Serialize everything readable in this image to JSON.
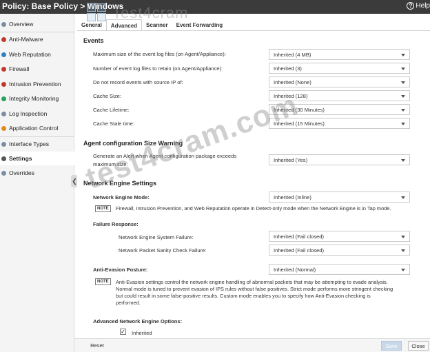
{
  "window": {
    "title": "Policy: Base Policy > Windows",
    "help": "Help"
  },
  "watermark": {
    "top": "Test4cram",
    "diagonal": "test4cram.com"
  },
  "sidebar": {
    "items": [
      {
        "label": "Overview",
        "color": "#7a8da3"
      },
      {
        "label": "Anti-Malware",
        "color": "#c0392b"
      },
      {
        "label": "Web Reputation",
        "color": "#2c80c5"
      },
      {
        "label": "Firewall",
        "color": "#c0392b"
      },
      {
        "label": "Intrusion Prevention",
        "color": "#c0392b"
      },
      {
        "label": "Integrity Monitoring",
        "color": "#27a060"
      },
      {
        "label": "Log Inspection",
        "color": "#7a8da3"
      },
      {
        "label": "Application Control",
        "color": "#e08a1e"
      },
      {
        "label": "Interface Types",
        "color": "#7a8da3"
      },
      {
        "label": "Settings",
        "color": "#555555"
      },
      {
        "label": "Overrides",
        "color": "#7a8da3"
      }
    ]
  },
  "tabs": [
    "General",
    "Advanced",
    "Scanner",
    "Event Forwarding"
  ],
  "events": {
    "heading": "Events",
    "rows": [
      {
        "label": "Maximum size of the event log files (on Agent/Appliance):",
        "value": "Inherited (4 MB)"
      },
      {
        "label": "Number of event log files to retain (on Agent/Appliance):",
        "value": "Inherited (3)"
      },
      {
        "label": "Do not record events with source IP of:",
        "value": "Inherited (None)"
      },
      {
        "label": "Cache Size:",
        "value": "Inherited (128)"
      },
      {
        "label": "Cache Lifetime:",
        "value": "Inherited (30 Minutes)"
      },
      {
        "label": "Cache Stale time:",
        "value": "Inherited (15 Minutes)"
      }
    ]
  },
  "agent_config": {
    "heading": "Agent configuration Size Warning",
    "label_line1": "Generate an Alert when Agent configuration package exceeds",
    "label_line2": "maximum size:",
    "value": "Inherited (Yes)"
  },
  "network_engine": {
    "heading": "Network Engine Settings",
    "mode_label": "Network Engine Mode:",
    "mode_value": "Inherited (Inline)",
    "note_tag": "NOTE",
    "mode_note": "Firewall, Intrusion Prevention, and Web Reputation operate in Detect-only mode when the Network Engine is in Tap mode.",
    "failure_heading": "Failure Response:",
    "system_failure_label": "Network Engine System Failure:",
    "system_failure_value": "Inherited (Fail closed)",
    "sanity_label": "Network Packet Sanity Check Failure:",
    "sanity_value": "Inherited (Fail closed)",
    "anti_evasion_label": "Anti-Evasion Posture:",
    "anti_evasion_value": "Inherited (Normal)",
    "anti_evasion_note": [
      "Anti-Evasion settings control the network engine handling of abnormal packets that may be attempting to evade analysis.",
      "Normal mode is tuned to prevent evasion of IPS rules without false positives. Strict mode performs more stringent checking",
      "but could result in some false-positive results. Custom mode enables you to specify how Anti-Evasion checking is",
      "performed."
    ],
    "advanced_label": "Advanced Network Engine Options:",
    "inherited_label": "Inherited",
    "inherited_checked": true
  },
  "footer": {
    "reset": "Reset",
    "save": "Save",
    "close": "Close"
  }
}
